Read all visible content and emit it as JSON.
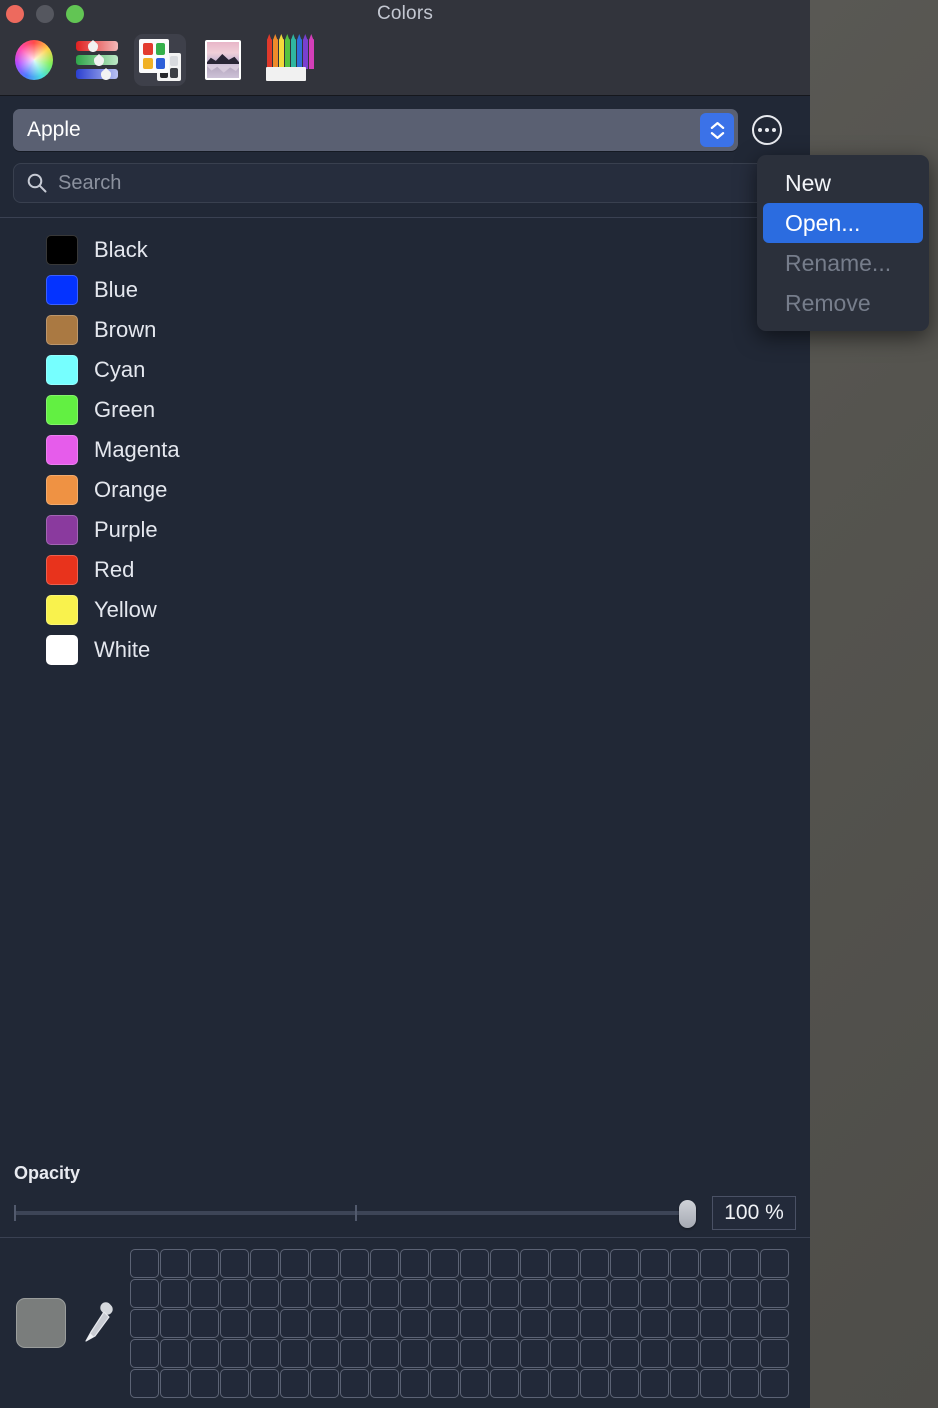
{
  "window": {
    "title": "Colors",
    "controls": [
      {
        "name": "close",
        "color": "#ed6a5e"
      },
      {
        "name": "minimize",
        "color": "#55575f"
      },
      {
        "name": "maximize",
        "color": "#62c554"
      }
    ]
  },
  "toolbar": {
    "items": [
      {
        "name": "color-wheel",
        "selected": false
      },
      {
        "name": "color-sliders",
        "selected": false
      },
      {
        "name": "color-palettes",
        "selected": true
      },
      {
        "name": "image-palettes",
        "selected": false
      },
      {
        "name": "pencils",
        "selected": false
      }
    ]
  },
  "list_picker": {
    "value": "Apple",
    "stepper_name": "stepper-arrows",
    "more_button_name": "more-options-button"
  },
  "search": {
    "placeholder": "Search",
    "value": ""
  },
  "colors": [
    {
      "name": "Black",
      "hex": "#000000"
    },
    {
      "name": "Blue",
      "hex": "#0433ff"
    },
    {
      "name": "Brown",
      "hex": "#aa7942"
    },
    {
      "name": "Cyan",
      "hex": "#76ffff"
    },
    {
      "name": "Green",
      "hex": "#62f042"
    },
    {
      "name": "Magenta",
      "hex": "#e65ceb"
    },
    {
      "name": "Orange",
      "hex": "#ef9243"
    },
    {
      "name": "Purple",
      "hex": "#8a3a9e"
    },
    {
      "name": "Red",
      "hex": "#e8331c"
    },
    {
      "name": "Yellow",
      "hex": "#f9f24d"
    },
    {
      "name": "White",
      "hex": "#ffffff"
    }
  ],
  "opacity": {
    "label": "Opacity",
    "value": "100 %",
    "percent": 100
  },
  "swatch_bar": {
    "current_color": "#7a7d7c",
    "eyedropper_name": "eyedropper-icon",
    "grid_columns": 22,
    "grid_rows": 5,
    "cell_color": "#222939"
  },
  "context_menu": {
    "items": [
      {
        "label": "New",
        "state": "normal"
      },
      {
        "label": "Open...",
        "state": "selected"
      },
      {
        "label": "Rename...",
        "state": "disabled"
      },
      {
        "label": "Remove",
        "state": "disabled"
      }
    ],
    "accent": "#2b6ce0"
  }
}
